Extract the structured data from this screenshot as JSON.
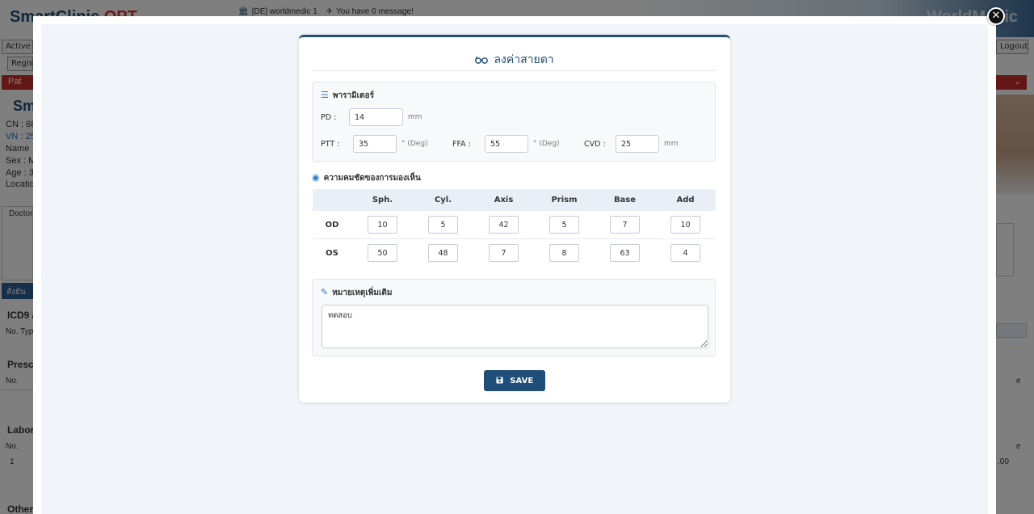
{
  "background": {
    "brand_left": "SmartClinic",
    "brand_left_suffix": "OPT",
    "brand_right": "WorldMedic",
    "header_clinic": "[DE] worldmedic 1",
    "header_message": "You have 0 message!",
    "active_tab": "Active P",
    "logout": "Logout",
    "register_tab": "Regis",
    "patient_bar": "Pat",
    "patient_sm": "Sm",
    "patient_info": [
      "CN : 68",
      "VN : 25",
      "Name",
      "Sex : M",
      "Age : 3",
      "Locatio"
    ],
    "doctor_label": "Doctor",
    "order_button": "สั่งยัน",
    "icd_title": "ICD9 /",
    "icd_cols": "No. Typ",
    "prescription_title": "Prescr",
    "prescription_col": "No.",
    "lab_title": "Labor",
    "lab_col": "No.",
    "lab_row": "1",
    "other_title": "Other",
    "right_e1": "e",
    "right_e2": "e",
    "right_amount": ".00"
  },
  "modal": {
    "close_symbol": "✕",
    "title": "ลงค่าสายตา",
    "params": {
      "heading": "พารามิเตอร์",
      "pd_label": "PD :",
      "pd_value": "14",
      "pd_unit": "mm",
      "ptt_label": "PTT :",
      "ptt_value": "35",
      "ptt_unit": "° (Deg)",
      "ffa_label": "FFA :",
      "ffa_value": "55",
      "ffa_unit": "° (Deg)",
      "cvd_label": "CVD :",
      "cvd_value": "25",
      "cvd_unit": "mm"
    },
    "vision": {
      "heading": "ความคมชัดของการมองเห็น",
      "columns": [
        "Sph.",
        "Cyl.",
        "Axis",
        "Prism",
        "Base",
        "Add"
      ],
      "rows": [
        {
          "label": "OD",
          "values": [
            "10",
            "5",
            "42",
            "5",
            "7",
            "10"
          ]
        },
        {
          "label": "OS",
          "values": [
            "50",
            "48",
            "7",
            "8",
            "63",
            "4"
          ]
        }
      ]
    },
    "notes": {
      "heading": "หมายเหตุเพิ่มเติม",
      "value": "ทดสอบ"
    },
    "save_label": "SAVE"
  },
  "colors": {
    "primary": "#1f4e79",
    "accent_icon": "#2b7bc0",
    "danger_bar": "#c9302c"
  },
  "icons": {
    "title": "glasses-icon",
    "params": "sliders-icon",
    "vision": "eye-icon",
    "notes": "edit-icon",
    "save": "floppy-disk-icon",
    "close": "close-icon"
  }
}
